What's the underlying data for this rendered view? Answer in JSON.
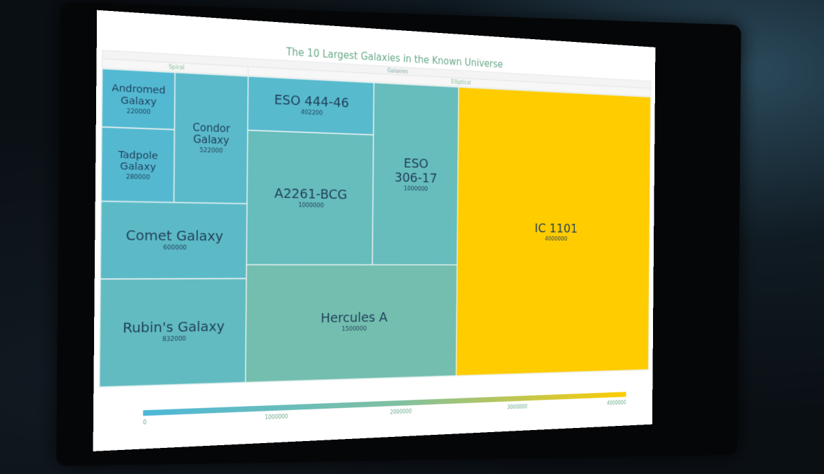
{
  "chart_data": {
    "type": "treemap",
    "title": "The 10 Largest Galaxies in the Known Universe",
    "root": "Galaxies",
    "groups": [
      {
        "name": "Spiral",
        "children": [
          {
            "name": "Andromed Galaxy",
            "value": 220000
          },
          {
            "name": "Tadpole Galaxy",
            "value": 280000
          },
          {
            "name": "Condor Galaxy",
            "value": 522000
          },
          {
            "name": "Comet Galaxy",
            "value": 600000
          },
          {
            "name": "Rubin's Galaxy",
            "value": 832000
          }
        ]
      },
      {
        "name": "Elliptical",
        "children": [
          {
            "name": "ESO 444-46",
            "value": 402200
          },
          {
            "name": "A2261-BCG",
            "value": 1000000
          },
          {
            "name": "ESO 306-17",
            "value": 1000000
          },
          {
            "name": "Hercules A",
            "value": 1500000
          },
          {
            "name": "IC 1101",
            "value": 4000000
          }
        ]
      }
    ],
    "color_scale": {
      "min": 0,
      "max": 4000000,
      "colors": [
        "#4db8d8",
        "#80c0a0",
        "#ffcc00"
      ],
      "ticks": [
        0,
        1000000,
        2000000,
        3000000,
        4000000
      ],
      "tick_labels": [
        "0",
        "1000000",
        "2000000",
        "3000000",
        "4000000"
      ]
    }
  }
}
